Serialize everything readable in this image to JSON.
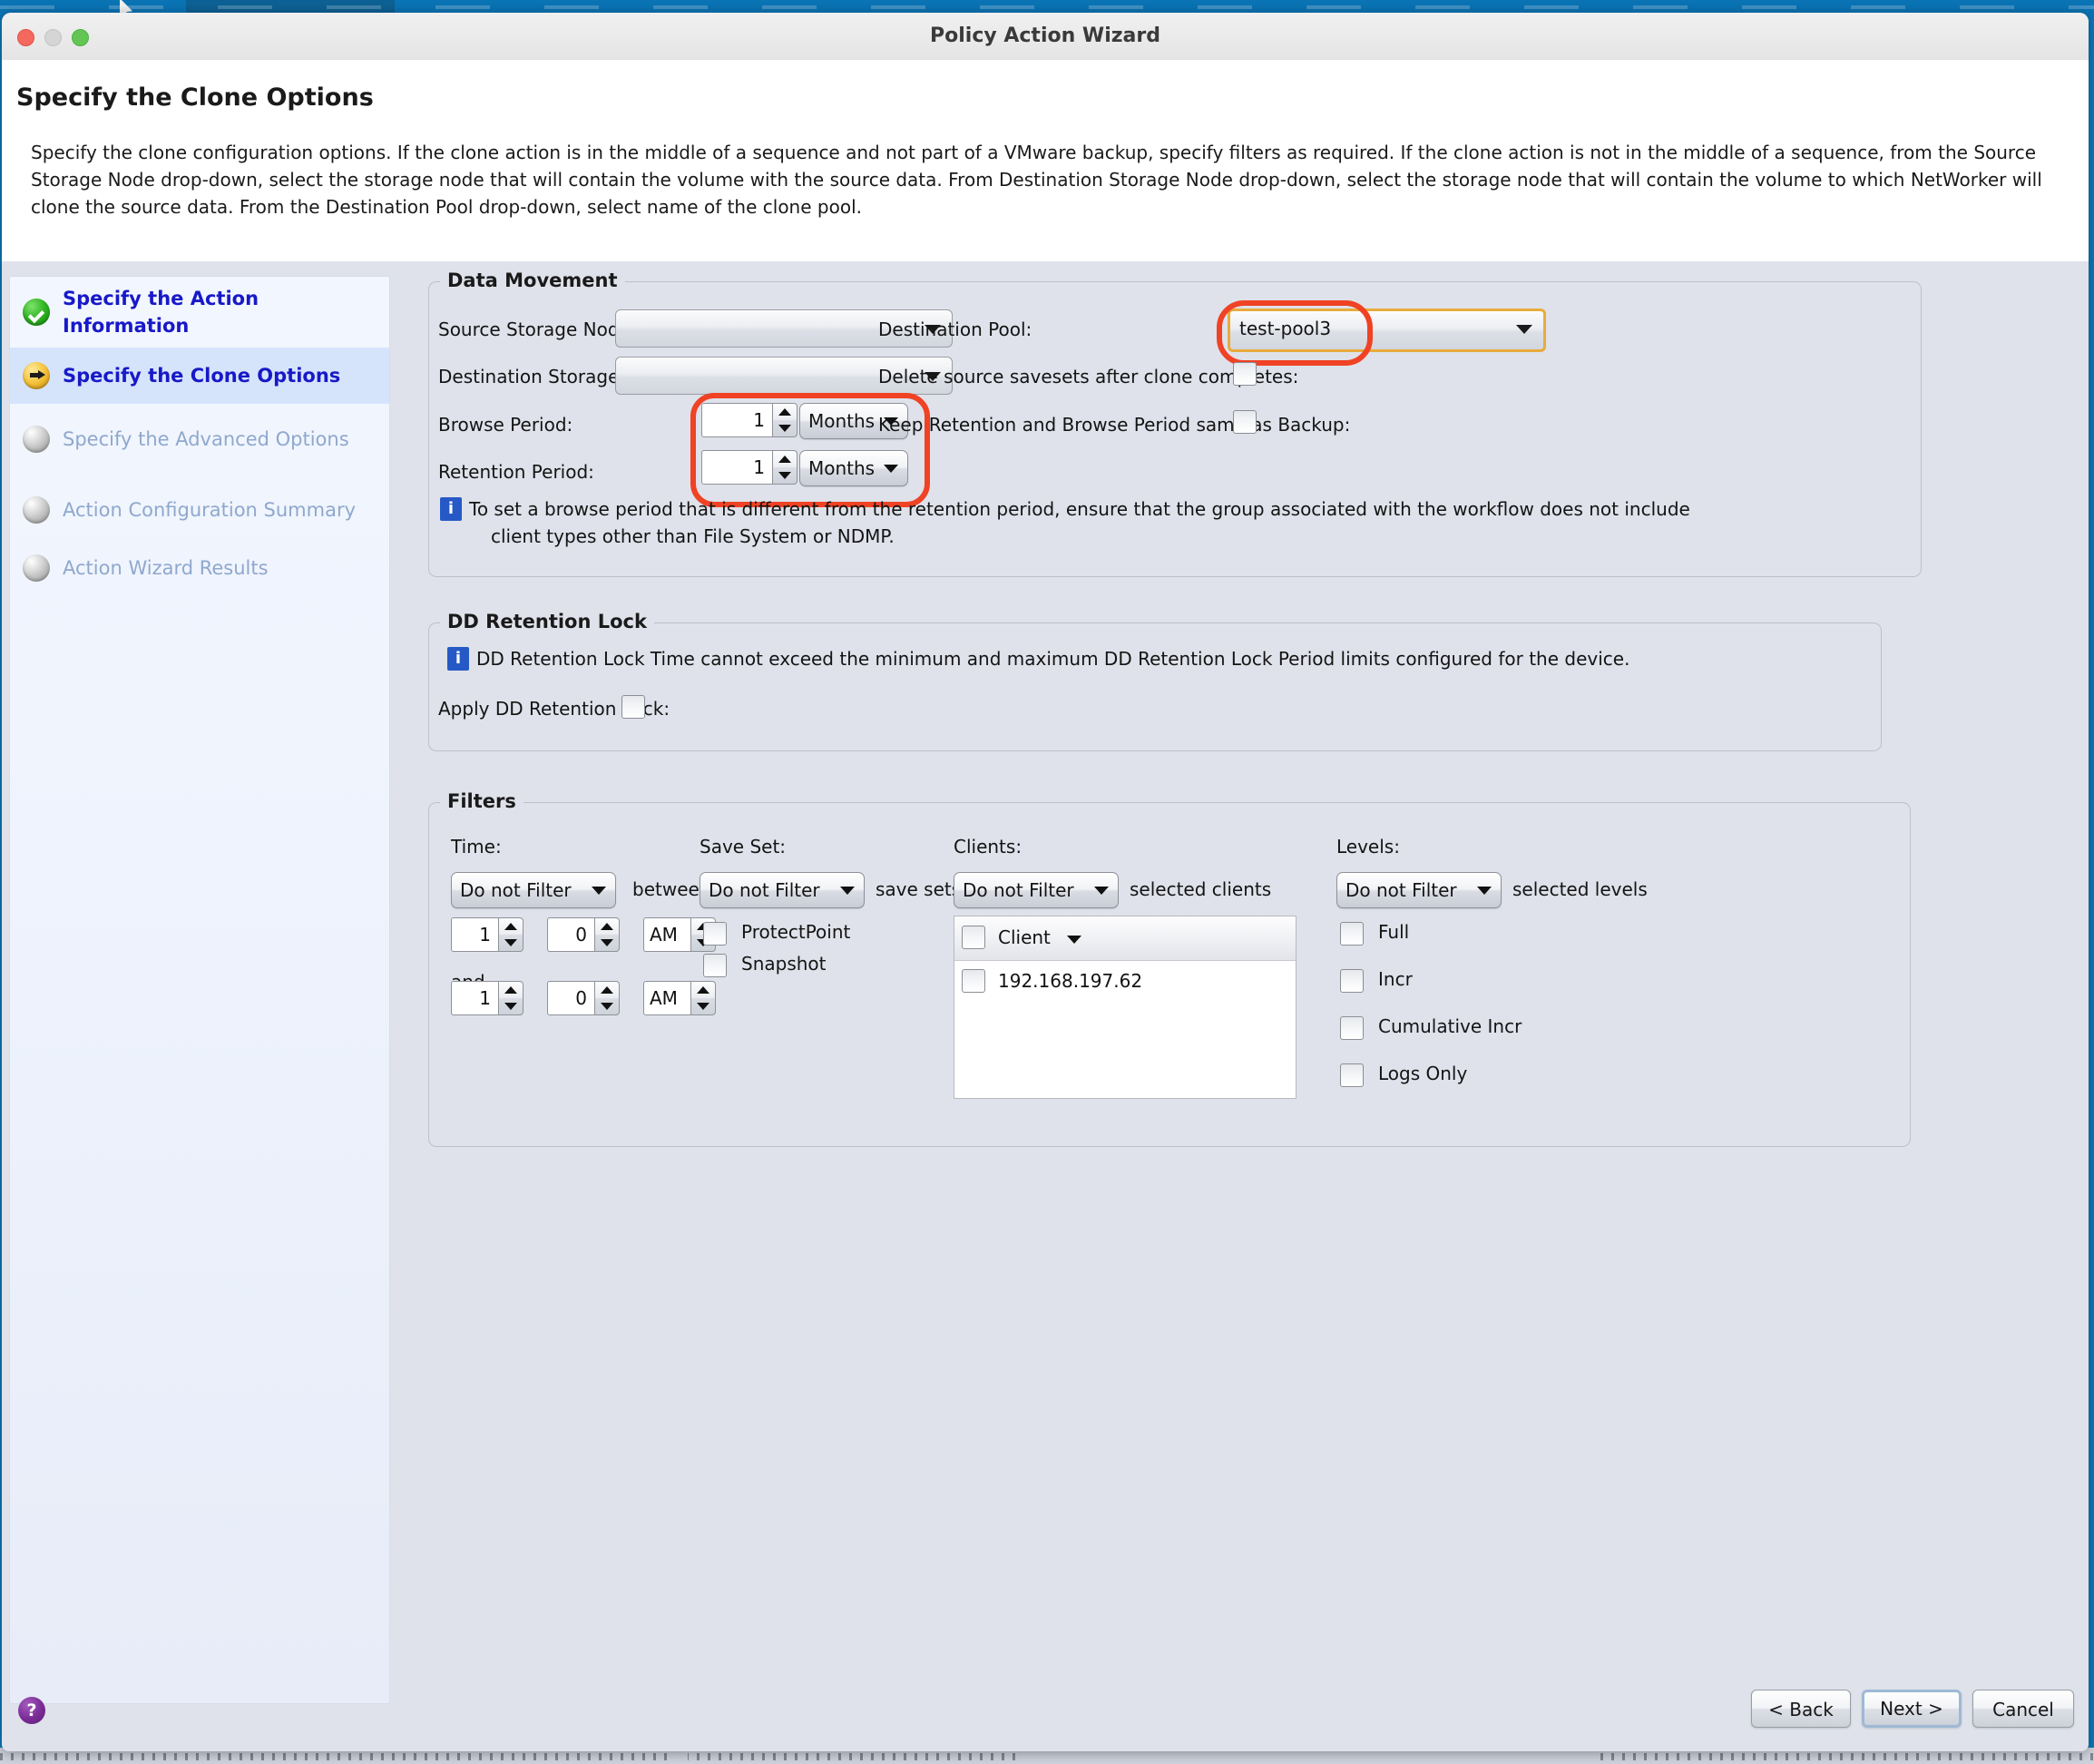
{
  "window": {
    "title": "Policy Action Wizard",
    "controls": {
      "close": "close",
      "minimize": "minimize",
      "maximize": "maximize"
    }
  },
  "header": {
    "title": "Specify the Clone Options",
    "description": "Specify the clone configuration options. If the clone action is in the middle of a sequence and not part of a VMware backup, specify filters as required. If the clone action is not in the middle of a sequence, from the Source Storage Node drop-down, select the storage node that will contain the volume with the source data. From Destination Storage Node drop-down, select the storage node that will contain the volume to which NetWorker will clone the source data. From the Destination Pool drop-down, select name of the clone pool."
  },
  "sidebar": {
    "items": [
      {
        "label": "Specify the Action Information",
        "state": "done",
        "icon": "check-circle-icon"
      },
      {
        "label": "Specify the Clone Options",
        "state": "current",
        "icon": "arrow-circle-icon"
      },
      {
        "label": "Specify the Advanced Options",
        "state": "todo",
        "icon": "pending-circle-icon"
      },
      {
        "label": "Action Configuration Summary",
        "state": "todo",
        "icon": "pending-circle-icon"
      },
      {
        "label": "Action Wizard Results",
        "state": "todo",
        "icon": "pending-circle-icon"
      }
    ]
  },
  "data_movement": {
    "legend": "Data Movement",
    "source_storage_node": {
      "label": "Source Storage Node:",
      "value": ""
    },
    "destination_storage_node": {
      "label": "Destination Storage Node:",
      "value": ""
    },
    "browse_period": {
      "label": "Browse Period:",
      "value": "1",
      "unit": "Months"
    },
    "retention_period": {
      "label": "Retention Period:",
      "value": "1",
      "unit": "Months"
    },
    "destination_pool": {
      "label": "Destination Pool:",
      "value": "test-pool3"
    },
    "delete_source": {
      "label": "Delete source savesets after clone completes:",
      "checked": false
    },
    "keep_retention": {
      "label": "Keep Retention and Browse Period same as Backup:",
      "checked": false
    },
    "note_line1": "To set a browse period that is different from the retention period, ensure that the group associated with the workflow does not include",
    "note_line2": "client types other than File System or NDMP.",
    "info_icon": "info-icon"
  },
  "dd_retention_lock": {
    "legend": "DD Retention Lock",
    "note": "DD Retention Lock Time cannot exceed the minimum and maximum DD Retention Lock Period limits configured for the device.",
    "apply": {
      "label": "Apply DD Retention Lock:",
      "checked": false
    },
    "info_icon": "info-icon"
  },
  "filters": {
    "legend": "Filters",
    "time": {
      "label": "Time:",
      "filter_value": "Do not Filter",
      "between_text": "between",
      "and_text": "and",
      "from": {
        "hour": "1",
        "minute": "0",
        "meridiem": "AM"
      },
      "to": {
        "hour": "1",
        "minute": "0",
        "meridiem": "AM"
      }
    },
    "save_set": {
      "label": "Save Set:",
      "filter_value": "Do not Filter",
      "suffix": "save sets of type",
      "options": [
        {
          "label": "ProtectPoint",
          "checked": false
        },
        {
          "label": "Snapshot",
          "checked": false
        }
      ]
    },
    "clients": {
      "label": "Clients:",
      "filter_value": "Do not Filter",
      "suffix": "selected clients",
      "column_header": "Client",
      "rows": [
        {
          "name": "192.168.197.62",
          "checked": false
        }
      ]
    },
    "levels": {
      "label": "Levels:",
      "filter_value": "Do not Filter",
      "suffix": "selected levels",
      "options": [
        {
          "label": "Full",
          "checked": false
        },
        {
          "label": "Incr",
          "checked": false
        },
        {
          "label": "Cumulative Incr",
          "checked": false
        },
        {
          "label": "Logs Only",
          "checked": false
        }
      ]
    }
  },
  "footer": {
    "help": "?",
    "back": "< Back",
    "next": "Next >",
    "cancel": "Cancel"
  },
  "colors": {
    "highlight_ring": "#f04224",
    "focus_field": "#e8ab3c",
    "link_blue": "#1819c8",
    "disabled_blue": "#8fa8cd",
    "info_blue": "#2659c6"
  }
}
